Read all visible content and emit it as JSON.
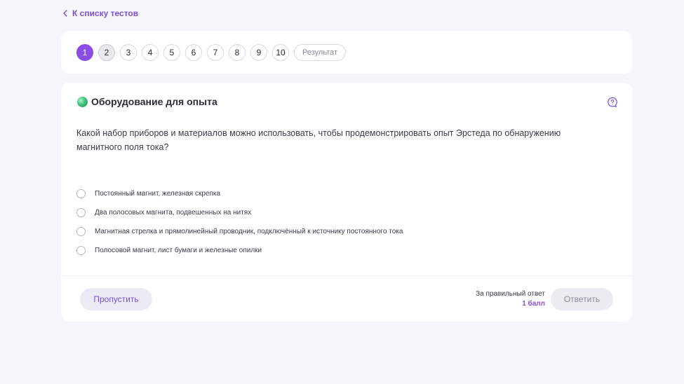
{
  "back_link": {
    "label": "К списку тестов"
  },
  "nav": {
    "questions": [
      "1",
      "2",
      "3",
      "4",
      "5",
      "6",
      "7",
      "8",
      "9",
      "10"
    ],
    "current_question": "1",
    "result_label": "Результат"
  },
  "question": {
    "title": "Оборудование для опыта",
    "text": "Какой набор приборов и материалов можно использовать, чтобы продемонстрировать опыт Эрстеда по обнаружению магнитного поля тока?",
    "options": [
      {
        "label": "Постоянный магнит, железная скрепка"
      },
      {
        "label": "Два полосовых магнита, подвешенных на нитях"
      },
      {
        "label": "Магнитная стрелка и прямолинейный проводник, подключённый к источнику постоянного тока"
      },
      {
        "label": "Полосовой магнит, лист бумаги и железные опилки"
      }
    ]
  },
  "footer": {
    "skip_label": "Пропустить",
    "score_label": "За правильный ответ",
    "score_value": "1 балл",
    "answer_label": "Ответить"
  },
  "colors": {
    "accent": "#8a4de8",
    "link": "#7b4fd6",
    "background": "#f5f5fa"
  }
}
